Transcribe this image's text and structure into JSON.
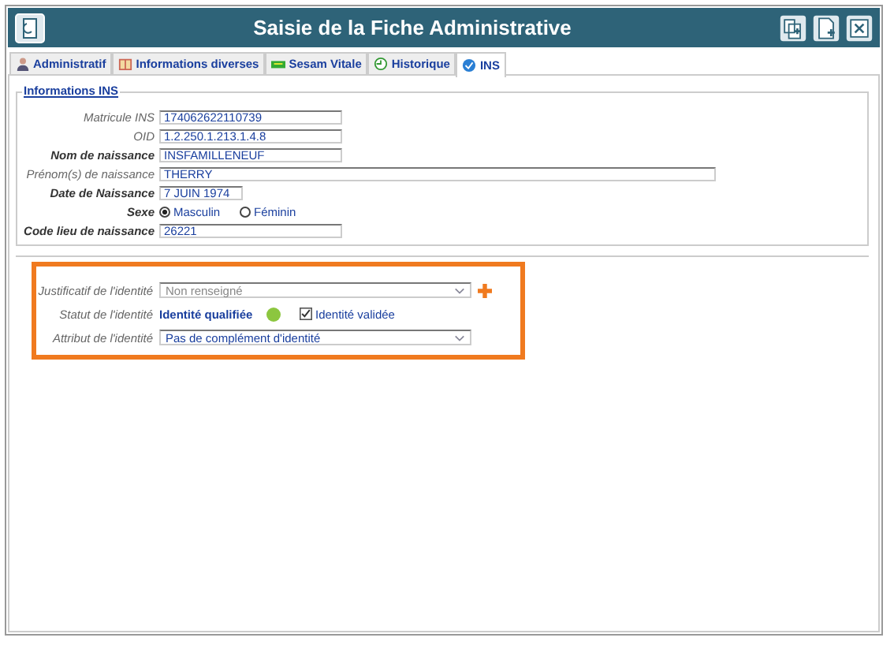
{
  "window": {
    "title": "Saisie de la Fiche Administrative"
  },
  "tabs": [
    {
      "label": "Administratif",
      "selected": false
    },
    {
      "label": "Informations diverses",
      "selected": false
    },
    {
      "label": "Sesam Vitale",
      "selected": false
    },
    {
      "label": "Historique",
      "selected": false
    },
    {
      "label": "INS",
      "selected": true
    }
  ],
  "section": {
    "title": "Informations INS",
    "fields": [
      {
        "label": "Matricule INS",
        "value": "174062622110739",
        "bold": false
      },
      {
        "label": "OID",
        "value": "1.2.250.1.213.1.4.8",
        "bold": false
      },
      {
        "label": "Nom de naissance",
        "value": "INSFAMILLENEUF",
        "bold": true
      },
      {
        "label": "Prénom(s) de naissance",
        "value": "THERRY",
        "bold": false
      },
      {
        "label": "Date de Naissance",
        "value": "7 JUIN 1974",
        "bold": true
      }
    ],
    "sex": {
      "label": "Sexe",
      "options": [
        {
          "label": "Masculin",
          "selected": true
        },
        {
          "label": "Féminin",
          "selected": false
        }
      ]
    },
    "birthplace": {
      "label": "Code lieu de naissance",
      "value": "26221"
    }
  },
  "identity": {
    "justificatif": {
      "label": "Justificatif de l'identité",
      "value": "Non renseigné"
    },
    "statut": {
      "label": "Statut de l'identité",
      "value": "Identité qualifiée",
      "color": "#8cc63f",
      "validated": {
        "label": "Identité validée",
        "checked": true
      }
    },
    "attribut": {
      "label": "Attribut de l'identité",
      "value": "Pas de complément d'identité"
    }
  }
}
